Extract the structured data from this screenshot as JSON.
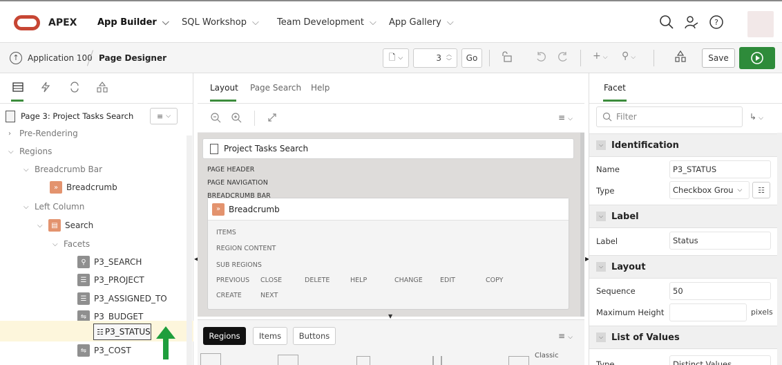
{
  "header": {
    "brand": "APEX",
    "nav": [
      {
        "label": "App Builder"
      },
      {
        "label": "SQL Workshop"
      },
      {
        "label": "Team Development"
      },
      {
        "label": "App Gallery"
      }
    ],
    "icons": [
      "search-icon",
      "user-settings-icon",
      "help-icon"
    ]
  },
  "toolbar": {
    "breadcrumb_app": "Application 100",
    "breadcrumb_current": "Page Designer",
    "page_number": "3",
    "go_label": "Go",
    "save_label": "Save"
  },
  "left": {
    "page_title": "Page 3: Project Tasks Search",
    "tree": {
      "pre_rendering": "Pre-Rendering",
      "regions": "Regions",
      "breadcrumb_bar": "Breadcrumb Bar",
      "breadcrumb": "Breadcrumb",
      "left_column": "Left Column",
      "search": "Search",
      "facets": "Facets",
      "items": [
        "P3_SEARCH",
        "P3_PROJECT",
        "P3_ASSIGNED_TO",
        "P3_BUDGET",
        "P3_COST"
      ],
      "dragged": "P3_STATUS"
    }
  },
  "center": {
    "tabs": [
      "Layout",
      "Page Search",
      "Help"
    ],
    "region_title": "Project Tasks Search",
    "captions": [
      "PAGE HEADER",
      "PAGE NAVIGATION",
      "BREADCRUMB BAR"
    ],
    "breadcrumb_region": "Breadcrumb",
    "slots": {
      "items": "ITEMS",
      "region_content": "REGION CONTENT",
      "sub_regions": "SUB REGIONS",
      "row1": [
        "PREVIOUS",
        "CLOSE",
        "DELETE",
        "HELP",
        "CHANGE",
        "EDIT",
        "COPY"
      ],
      "row2": [
        "CREATE",
        "NEXT"
      ]
    },
    "gallery_tabs": [
      "Regions",
      "Items",
      "Buttons"
    ],
    "gallery_items": [
      "Classic"
    ]
  },
  "right": {
    "tab": "Facet",
    "filter_placeholder": "Filter",
    "sections": {
      "identification": "Identification",
      "label": "Label",
      "layout": "Layout",
      "lov": "List of Values"
    },
    "props": {
      "name_label": "Name",
      "name_value": "P3_STATUS",
      "type_label": "Type",
      "type_value": "Checkbox Grou",
      "label_label": "Label",
      "label_value": "Status",
      "sequence_label": "Sequence",
      "sequence_value": "50",
      "max_height_label": "Maximum Height",
      "max_height_unit": "pixels",
      "lov_type_label": "Type",
      "lov_type_value": "Distinct Values"
    }
  },
  "colors": {
    "brand_red": "#c74634",
    "run_green": "#2e8b3a",
    "accent_green": "#3c8c3c",
    "item_orange": "#e3936e"
  }
}
